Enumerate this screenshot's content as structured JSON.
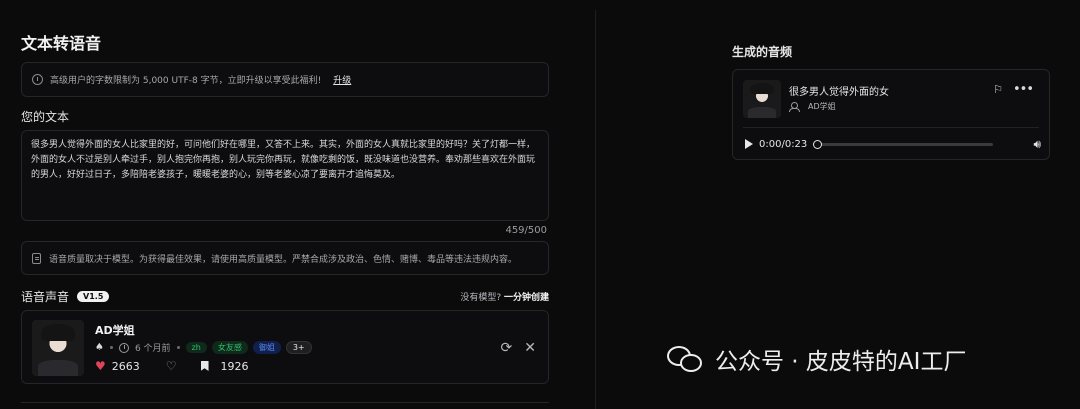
{
  "page": {
    "title": "文本转语音"
  },
  "notice": {
    "text": "高级用户的字数限制为 5,000 UTF-8 字节，立即升级以享受此福利!",
    "upgrade_label": "升级"
  },
  "text_section": {
    "label": "您的文本",
    "content": "很多男人觉得外面的女人比家里的好，可问他们好在哪里，又答不上来。其实，外面的女人真就比家里的好吗？关了灯都一样，外面的女人不过是别人牵过手，别人抱完你再抱，别人玩完你再玩，就像吃剩的饭，既没味道也没营养。奉劝那些喜欢在外面玩的男人，好好过日子，多陪陪老婆孩子，暖暖老婆的心，别等老婆心凉了要离开才追悔莫及。",
    "counter": "459/500"
  },
  "quality_notice": "语音质量取决于模型。为获得最佳效果，请使用高质量模型。严禁合成涉及政治、色情、赌博、毒品等违法违规内容。",
  "voice": {
    "label": "语音声音",
    "version": "V1.5",
    "no_model_prefix": "没有模型?",
    "create_link": "一分钟创建",
    "card": {
      "name": "AD学姐",
      "age": "6 个月前",
      "tags": [
        "zh",
        "女友感",
        "御姐"
      ],
      "more_tags": "3+",
      "likes": "2663",
      "bookmarks": "1926"
    }
  },
  "generated": {
    "title": "生成的音频",
    "audio_title": "很多男人觉得外面的女",
    "user": "AD学姐",
    "time": "0:00/0:23",
    "progress": 0
  },
  "watermark": "公众号 · 皮皮特的AI工厂",
  "colors": {
    "accent_green": "#2fbf6b",
    "accent_blue": "#5b86f0",
    "like_red": "#e0435a"
  },
  "icons": {
    "notice": "info-circle-icon",
    "quality": "document-icon",
    "voice_logo": "voice-avatar-icon",
    "time": "clock-icon",
    "like": "heart-filled-icon",
    "unlike": "heart-outline-icon",
    "bookmark": "bookmark-icon",
    "refresh": "refresh-icon",
    "close": "close-icon",
    "dislike": "thumbs-down-icon",
    "more": "more-icon",
    "play": "play-icon",
    "volume": "volume-icon"
  }
}
